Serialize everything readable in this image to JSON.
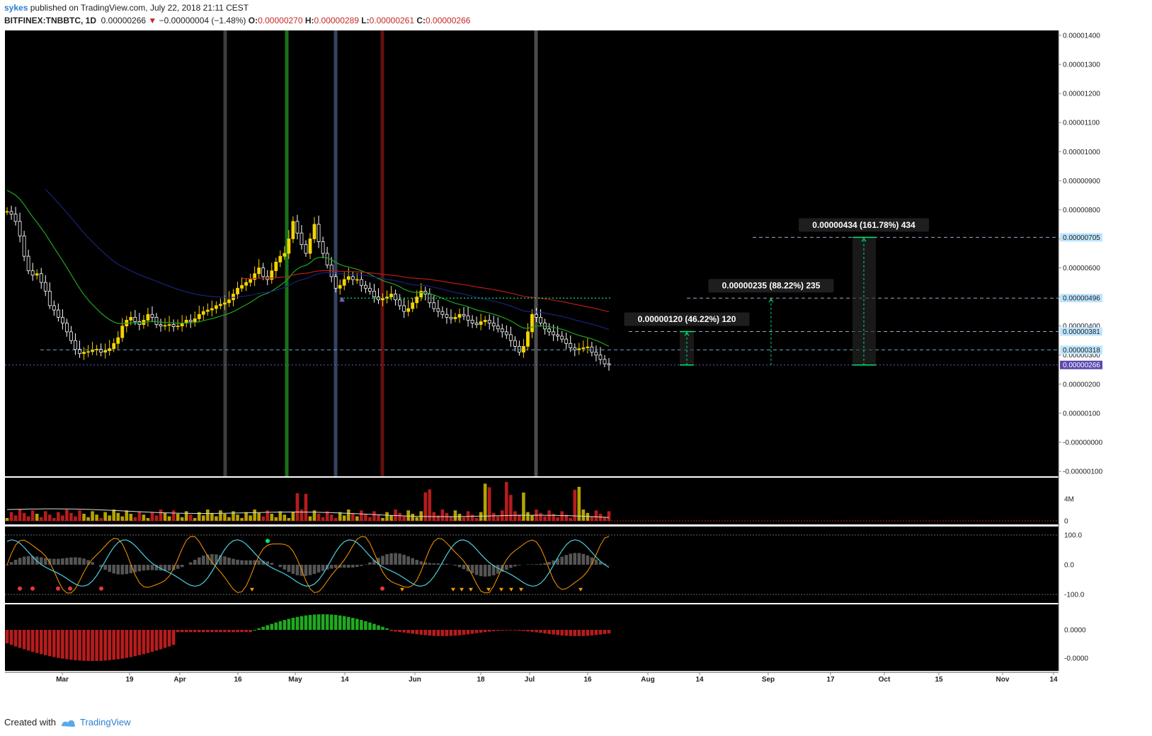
{
  "header": {
    "publisher": "sykes",
    "published_text": "published on TradingView.com, July 22, 2018 21:11 CEST",
    "symbol": "BITFINEX:TNBBTC, 1D",
    "last": "0.00000266",
    "change": "−0.00000004 (−1.48%)",
    "o_label": "O:",
    "o": "0.00000270",
    "h_label": "H:",
    "h": "0.00000289",
    "l_label": "L:",
    "l": "0.00000261",
    "c_label": "C:",
    "c": "0.00000266"
  },
  "footer": {
    "created_with": "Created with",
    "brand": "TradingView"
  },
  "colors": {
    "background": "#000000",
    "candle_up": "#f5d300",
    "candle_down": "#ffffff",
    "ema_short": "#1fa61f",
    "ema_mid": "#1a237e",
    "ema_long": "#b71c1c",
    "target_line": "#00e676",
    "price_label": "#5c48b0",
    "axis_tag": "#bfe5ff"
  },
  "chart_data": [
    {
      "type": "candlestick",
      "name": "price",
      "x_ticks": [
        "Mar",
        "19",
        "Apr",
        "16",
        "May",
        "14",
        "Jun",
        "18",
        "Jul",
        "16",
        "Aug",
        "14",
        "Sep",
        "17",
        "Oct",
        "15",
        "Nov",
        "14"
      ],
      "y_ticks": [
        "0.00001400",
        "0.00001300",
        "0.00001200",
        "0.00001100",
        "0.00001000",
        "0.00000900",
        "0.00000800",
        "0.00000700",
        "0.00000600",
        "0.00000500",
        "0.00000400",
        "0.00000300",
        "0.00000200",
        "0.00000100",
        "-0.00000000",
        "-0.00000100"
      ],
      "ylim": [
        -1e-06,
        1.4e-05
      ],
      "close_series_1d": [
        794,
        785,
        760,
        710,
        640,
        590,
        575,
        580,
        550,
        520,
        470,
        455,
        430,
        410,
        380,
        350,
        320,
        305,
        310,
        312,
        318,
        320,
        310,
        315,
        322,
        340,
        360,
        400,
        420,
        430,
        415,
        405,
        420,
        440,
        430,
        405,
        400,
        402,
        405,
        398,
        400,
        410,
        420,
        415,
        425,
        440,
        450,
        455,
        460,
        470,
        475,
        480,
        490,
        510,
        530,
        540,
        550,
        560,
        580,
        600,
        570,
        560,
        590,
        620,
        640,
        650,
        700,
        760,
        720,
        680,
        650,
        700,
        750,
        690,
        650,
        610,
        570,
        530,
        540,
        560,
        570,
        560,
        560,
        540,
        530,
        520,
        500,
        490,
        495,
        500,
        510,
        490,
        470,
        450,
        460,
        480,
        500,
        520,
        510,
        480,
        460,
        450,
        440,
        430,
        425,
        430,
        440,
        435,
        420,
        410,
        405,
        415,
        420,
        410,
        400,
        390,
        380,
        370,
        350,
        330,
        310,
        330,
        380,
        440,
        430,
        410,
        390,
        380,
        370,
        365,
        355,
        340,
        325,
        318,
        322,
        325,
        328,
        310,
        300,
        285,
        270,
        266
      ],
      "ema_short_last": 3.18e-06,
      "ema_mid_last": 3.81e-06,
      "ema_long_last": 4.6e-06,
      "last_price": "0.00000266",
      "support_level": "0.00000318",
      "axis_tags": [
        "0.00000705",
        "0.00000496",
        "0.00000381",
        "0.00000318",
        "0.00000266"
      ],
      "targets": [
        {
          "label": "0.00000120 (46.22%) 120",
          "from": 2.66e-06,
          "to": 3.81e-06
        },
        {
          "label": "0.00000235 (88.22%) 235",
          "from": 2.66e-06,
          "to": 4.96e-06
        },
        {
          "label": "0.00000434 (161.78%) 434",
          "from": 2.66e-06,
          "to": 7.05e-06
        }
      ]
    },
    {
      "type": "bar",
      "name": "volume",
      "y_ticks": [
        "4M",
        "0"
      ]
    },
    {
      "type": "line",
      "name": "oscillator",
      "y_ticks": [
        "100.0",
        "0.0",
        "-100.0"
      ],
      "ylim": [
        -100,
        100
      ]
    },
    {
      "type": "bar",
      "name": "histogram",
      "y_ticks": [
        "0.0000",
        "-0.0000"
      ]
    }
  ]
}
